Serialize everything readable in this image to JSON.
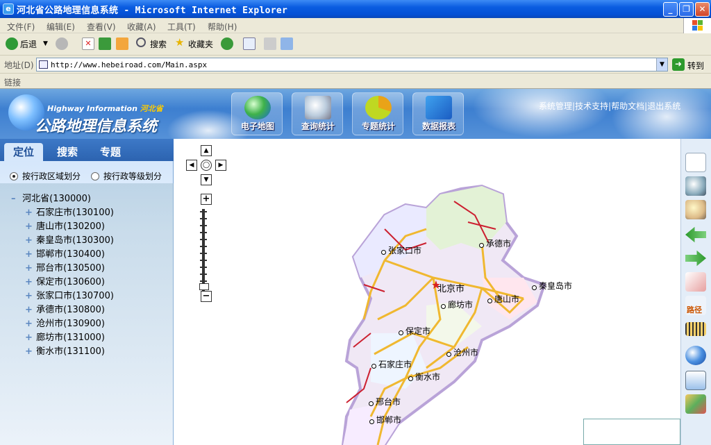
{
  "window": {
    "title": "河北省公路地理信息系统 - Microsoft Internet Explorer",
    "minimize": "_",
    "restore": "❐",
    "close": "✕"
  },
  "menu": [
    "文件(F)",
    "编辑(E)",
    "查看(V)",
    "收藏(A)",
    "工具(T)",
    "帮助(H)"
  ],
  "toolbar": {
    "back": "后退",
    "search": "搜索",
    "favorites": "收藏夹"
  },
  "address": {
    "label": "地址(D)",
    "url": "http://www.hebeiroad.com/Main.aspx",
    "go": "转到"
  },
  "links_label": "链接",
  "site": {
    "subtitle_en": "Highway Information",
    "subtitle_cn": "河北省",
    "title": "公路地理信息系统",
    "nav": [
      {
        "label": "电子地图",
        "icon": "globe-icon"
      },
      {
        "label": "查询统计",
        "icon": "magnifier-icon"
      },
      {
        "label": "专题统计",
        "icon": "pie-chart-icon"
      },
      {
        "label": "数据报表",
        "icon": "books-icon"
      }
    ],
    "top_links": [
      "系统管理",
      "技术支持",
      "帮助文档",
      "退出系统"
    ],
    "top_links_sep": "|"
  },
  "left": {
    "tabs": [
      "定位",
      "搜索",
      "专题"
    ],
    "radio1": "按行政区域划分",
    "radio2": "按行政等级划分",
    "tree_root": "河北省(130000)",
    "tree_items": [
      "石家庄市(130100)",
      "唐山市(130200)",
      "秦皇岛市(130300)",
      "邯郸市(130400)",
      "邢台市(130500)",
      "保定市(130600)",
      "张家口市(130700)",
      "承德市(130800)",
      "沧州市(130900)",
      "廊坊市(131000)",
      "衡水市(131100)"
    ]
  },
  "map": {
    "cities": [
      "张家口市",
      "承德市",
      "北京市",
      "秦皇岛市",
      "廊坊市",
      "唐山市",
      "保定市",
      "沧州市",
      "石家庄市",
      "衡水市",
      "邢台市",
      "邯郸市"
    ],
    "path_tool": "路径"
  }
}
